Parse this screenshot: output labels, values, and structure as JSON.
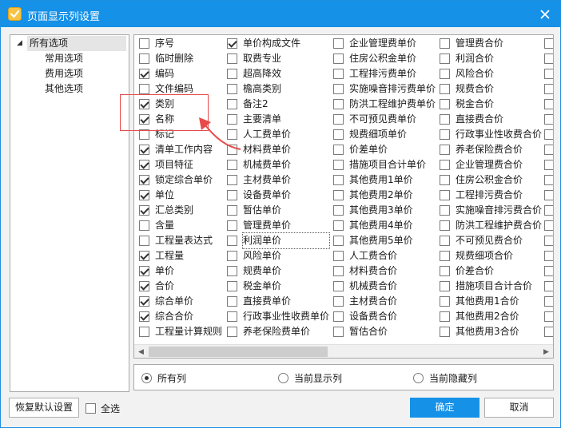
{
  "window": {
    "title": "页面显示列设置",
    "accent": "#1591e8"
  },
  "tree": {
    "root": "所有选项",
    "children": [
      "常用选项",
      "费用选项",
      "其他选项"
    ]
  },
  "columns": [
    [
      {
        "label": "序号",
        "checked": false
      },
      {
        "label": "临时删除",
        "checked": false
      },
      {
        "label": "编码",
        "checked": true
      },
      {
        "label": "文件编码",
        "checked": false
      },
      {
        "label": "类别",
        "checked": true
      },
      {
        "label": "名称",
        "checked": true
      },
      {
        "label": "标记",
        "checked": false
      },
      {
        "label": "清单工作内容",
        "checked": true
      },
      {
        "label": "项目特征",
        "checked": true
      },
      {
        "label": "锁定综合单价",
        "checked": true
      },
      {
        "label": "单位",
        "checked": true
      },
      {
        "label": "汇总类别",
        "checked": true
      },
      {
        "label": "含量",
        "checked": false
      },
      {
        "label": "工程量表达式",
        "checked": false
      },
      {
        "label": "工程量",
        "checked": true
      },
      {
        "label": "单价",
        "checked": true
      },
      {
        "label": "合价",
        "checked": true
      },
      {
        "label": "综合单价",
        "checked": true
      },
      {
        "label": "综合合价",
        "checked": true
      },
      {
        "label": "工程量计算规则",
        "checked": false
      }
    ],
    [
      {
        "label": "单价构成文件",
        "checked": true
      },
      {
        "label": "取费专业",
        "checked": false
      },
      {
        "label": "超高降效",
        "checked": false
      },
      {
        "label": "檐高类别",
        "checked": false
      },
      {
        "label": "备注2",
        "checked": false
      },
      {
        "label": "主要清单",
        "checked": false
      },
      {
        "label": "人工费单价",
        "checked": false
      },
      {
        "label": "材料费单价",
        "checked": false
      },
      {
        "label": "机械费单价",
        "checked": false
      },
      {
        "label": "主材费单价",
        "checked": false
      },
      {
        "label": "设备费单价",
        "checked": false
      },
      {
        "label": "暂估单价",
        "checked": false
      },
      {
        "label": "管理费单价",
        "checked": false
      },
      {
        "label": "利润单价",
        "checked": false
      },
      {
        "label": "风险单价",
        "checked": false
      },
      {
        "label": "规费单价",
        "checked": false
      },
      {
        "label": "税金单价",
        "checked": false
      },
      {
        "label": "直接费单价",
        "checked": false
      },
      {
        "label": "行政事业性收费单价",
        "checked": false
      },
      {
        "label": "养老保险费单价",
        "checked": false
      }
    ],
    [
      {
        "label": "企业管理费单价",
        "checked": false
      },
      {
        "label": "住房公积金单价",
        "checked": false
      },
      {
        "label": "工程排污费单价",
        "checked": false
      },
      {
        "label": "实施噪音排污费单价",
        "checked": false
      },
      {
        "label": "防洪工程维护费单价",
        "checked": false
      },
      {
        "label": "不可预见费单价",
        "checked": false
      },
      {
        "label": "规费细项单价",
        "checked": false
      },
      {
        "label": "价差单价",
        "checked": false
      },
      {
        "label": "措施项目合计单价",
        "checked": false
      },
      {
        "label": "其他费用1单价",
        "checked": false
      },
      {
        "label": "其他费用2单价",
        "checked": false
      },
      {
        "label": "其他费用3单价",
        "checked": false
      },
      {
        "label": "其他费用4单价",
        "checked": false
      },
      {
        "label": "其他费用5单价",
        "checked": false
      },
      {
        "label": "人工费合价",
        "checked": false
      },
      {
        "label": "材料费合价",
        "checked": false
      },
      {
        "label": "机械费合价",
        "checked": false
      },
      {
        "label": "主材费合价",
        "checked": false
      },
      {
        "label": "设备费合价",
        "checked": false
      },
      {
        "label": "暂估合价",
        "checked": false
      }
    ],
    [
      {
        "label": "管理费合价",
        "checked": false
      },
      {
        "label": "利润合价",
        "checked": false
      },
      {
        "label": "风险合价",
        "checked": false
      },
      {
        "label": "规费合价",
        "checked": false
      },
      {
        "label": "税金合价",
        "checked": false
      },
      {
        "label": "直接费合价",
        "checked": false
      },
      {
        "label": "行政事业性收费合价",
        "checked": false
      },
      {
        "label": "养老保险费合价",
        "checked": false
      },
      {
        "label": "企业管理费合价",
        "checked": false
      },
      {
        "label": "住房公积金合价",
        "checked": false
      },
      {
        "label": "工程排污费合价",
        "checked": false
      },
      {
        "label": "实施噪音排污费合价",
        "checked": false
      },
      {
        "label": "防洪工程维护费合价",
        "checked": false
      },
      {
        "label": "不可预见费合价",
        "checked": false
      },
      {
        "label": "规费细项合价",
        "checked": false
      },
      {
        "label": "价差合价",
        "checked": false
      },
      {
        "label": "措施项目合计合价",
        "checked": false
      },
      {
        "label": "其他费用1合价",
        "checked": false
      },
      {
        "label": "其他费用2合价",
        "checked": false
      },
      {
        "label": "其他费用3合价",
        "checked": false
      }
    ]
  ],
  "radios": [
    {
      "label": "所有列",
      "selected": true
    },
    {
      "label": "当前显示列",
      "selected": false
    },
    {
      "label": "当前隐藏列",
      "selected": false
    }
  ],
  "buttons": {
    "restore": "恢复默认设置",
    "select_all": "全选",
    "ok": "确定",
    "cancel": "取消"
  }
}
